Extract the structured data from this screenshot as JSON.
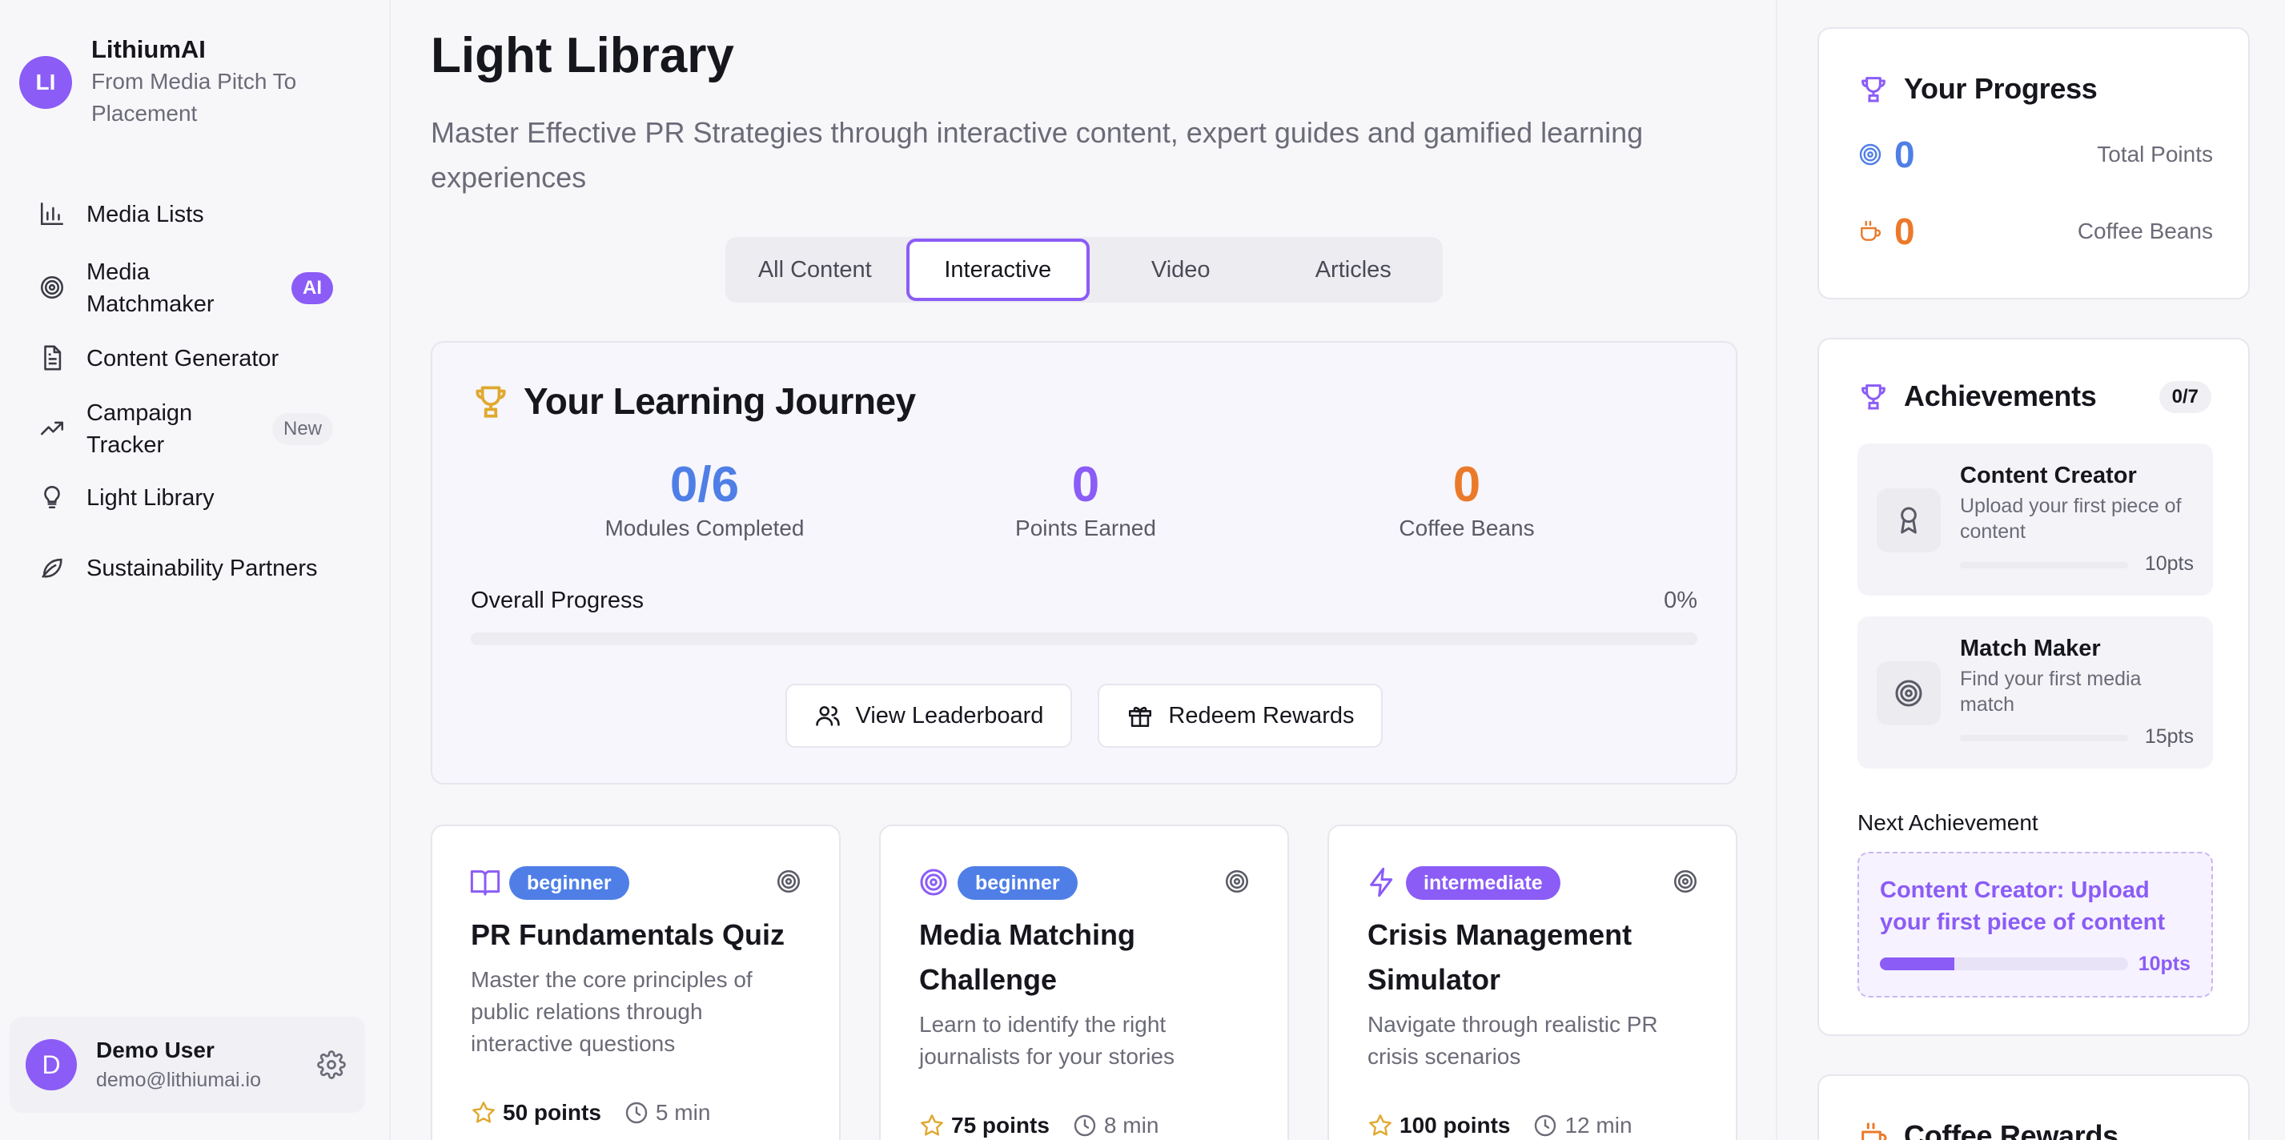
{
  "brand": {
    "initials": "LI",
    "name": "LithiumAI",
    "tagline": "From Media Pitch To Placement"
  },
  "nav": {
    "items": [
      {
        "label": "Media Lists",
        "icon": "bar-chart-icon"
      },
      {
        "label": "Media Matchmaker",
        "icon": "target-icon",
        "badge": "AI"
      },
      {
        "label": "Content Generator",
        "icon": "document-icon"
      },
      {
        "label": "Campaign Tracker",
        "icon": "trending-up-icon",
        "badge": "New"
      },
      {
        "label": "Light Library",
        "icon": "lightbulb-icon"
      },
      {
        "label": "Sustainability Partners",
        "icon": "leaf-icon"
      }
    ]
  },
  "user": {
    "initial": "D",
    "name": "Demo User",
    "email": "demo@lithiumai.io"
  },
  "page": {
    "title": "Light Library",
    "subtitle": "Master Effective PR Strategies through interactive content, expert guides and gamified learning experiences"
  },
  "tabs": [
    {
      "label": "All Content",
      "active": false
    },
    {
      "label": "Interactive",
      "active": true
    },
    {
      "label": "Video",
      "active": false
    },
    {
      "label": "Articles",
      "active": false
    }
  ],
  "journey": {
    "title": "Your Learning Journey",
    "stats": [
      {
        "value": "0/6",
        "label": "Modules Completed",
        "color": "#4f7fe6"
      },
      {
        "value": "0",
        "label": "Points Earned",
        "color": "#8b5cf6"
      },
      {
        "value": "0",
        "label": "Coffee Beans",
        "color": "#ea7a2a"
      }
    ],
    "progress_label": "Overall Progress",
    "progress_pct_text": "0%",
    "progress_value": 0,
    "leaderboard_label": "View Leaderboard",
    "rewards_label": "Redeem Rewards"
  },
  "cards": [
    {
      "icon": "book-open-icon",
      "level": "beginner",
      "level_color": "#4f7fe6",
      "title": "PR Fundamentals Quiz",
      "desc": "Master the core principles of public relations through interactive questions",
      "points": "50 points",
      "time": "5 min"
    },
    {
      "icon": "target-icon",
      "level": "beginner",
      "level_color": "#4f7fe6",
      "title": "Media Matching Challenge",
      "desc": "Learn to identify the right journalists for your stories",
      "points": "75 points",
      "time": "8 min"
    },
    {
      "icon": "lightning-icon",
      "level": "intermediate",
      "level_color": "#8b5cf6",
      "title": "Crisis Management Simulator",
      "desc": "Navigate through realistic PR crisis scenarios",
      "points": "100 points",
      "time": "12 min"
    }
  ],
  "progress_panel": {
    "title": "Your Progress",
    "points_value": "0",
    "points_label": "Total Points",
    "beans_value": "0",
    "beans_label": "Coffee Beans",
    "points_color": "#4f7fe6",
    "beans_color": "#ea7a2a"
  },
  "achievements": {
    "title": "Achievements",
    "count": "0/7",
    "items": [
      {
        "title": "Content Creator",
        "desc": "Upload your first piece of content",
        "points": "10pts",
        "icon": "award-icon"
      },
      {
        "title": "Match Maker",
        "desc": "Find your first media match",
        "points": "15pts",
        "icon": "target-icon"
      }
    ],
    "next_label": "Next Achievement",
    "next_text": "Content Creator: Upload your first piece of content",
    "next_points": "10pts",
    "next_progress": 0.3
  },
  "coffee_rewards": {
    "title": "Coffee Rewards"
  },
  "colors": {
    "accent": "#8b5cf6",
    "blue": "#4f7fe6",
    "orange": "#ea7a2a",
    "gold": "#e0a82e"
  }
}
